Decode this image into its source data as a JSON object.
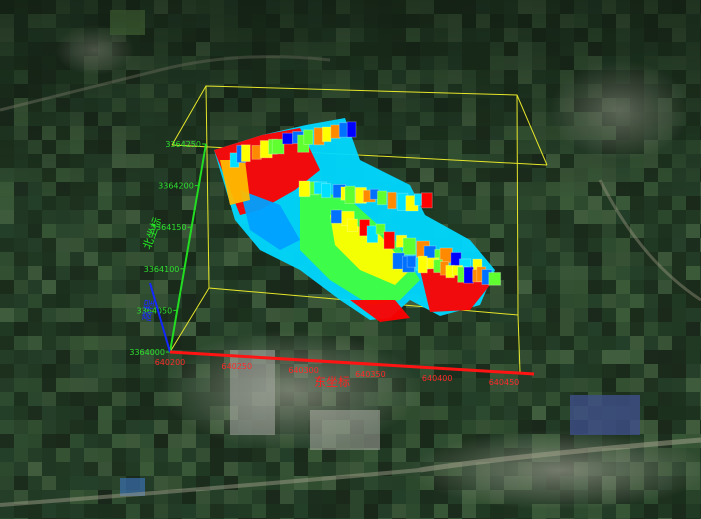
{
  "viewer": {
    "colors": {
      "bounding_box": "#e6e62a",
      "x_axis": "#ff1414",
      "y_axis": "#22dd22",
      "z_axis": "#1428ff",
      "model_palette": [
        "#ff0000",
        "#ff8a00",
        "#ffff00",
        "#60ff30",
        "#00e0ff",
        "#0070ff",
        "#0000ff"
      ]
    },
    "icons": [
      "terrain-imagery",
      "voxel-model"
    ]
  },
  "axes": {
    "x": {
      "label": "东坐标",
      "ticks": [
        "640200",
        "640250",
        "640300",
        "640350",
        "640400",
        "640450"
      ]
    },
    "y": {
      "label": "北坐标",
      "ticks": [
        "3364000",
        "3364050",
        "3364100",
        "3364150",
        "3364200",
        "3364250"
      ]
    },
    "z": {
      "label": "高程"
    }
  }
}
